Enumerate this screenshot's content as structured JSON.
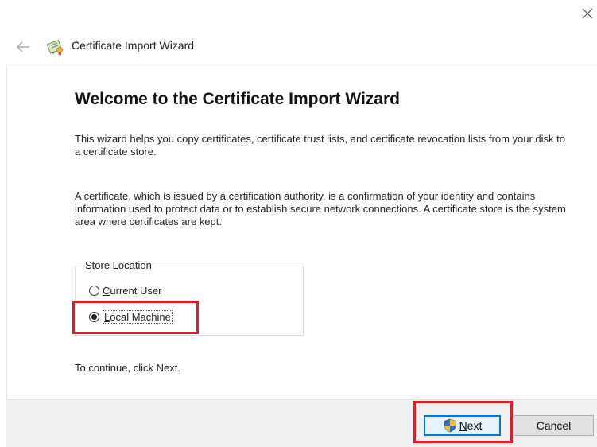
{
  "window": {
    "title": "Certificate Import Wizard"
  },
  "wizard": {
    "heading": "Welcome to the Certificate Import Wizard",
    "paragraph1": "This wizard helps you copy certificates, certificate trust lists, and certificate revocation lists from your disk to a certificate store.",
    "paragraph2": "A certificate, which is issued by a certification authority, is a confirmation of your identity and contains information used to protect data or to establish secure network connections. A certificate store is the system area where certificates are kept.",
    "store_location": {
      "label": "Store Location",
      "options": [
        {
          "label": "Current User",
          "selected": false
        },
        {
          "label": "Local Machine",
          "selected": true
        }
      ]
    },
    "continue_text": "To continue, click Next."
  },
  "footer": {
    "next_label": "Next",
    "cancel_label": "Cancel"
  },
  "colors": {
    "highlight": "#d8202a",
    "footer_bg": "#f0f0f0",
    "next_border": "#0078d7"
  },
  "icons": {
    "close": "close-icon",
    "back": "back-arrow-icon",
    "app": "certificate-icon",
    "next": "shield-icon"
  }
}
